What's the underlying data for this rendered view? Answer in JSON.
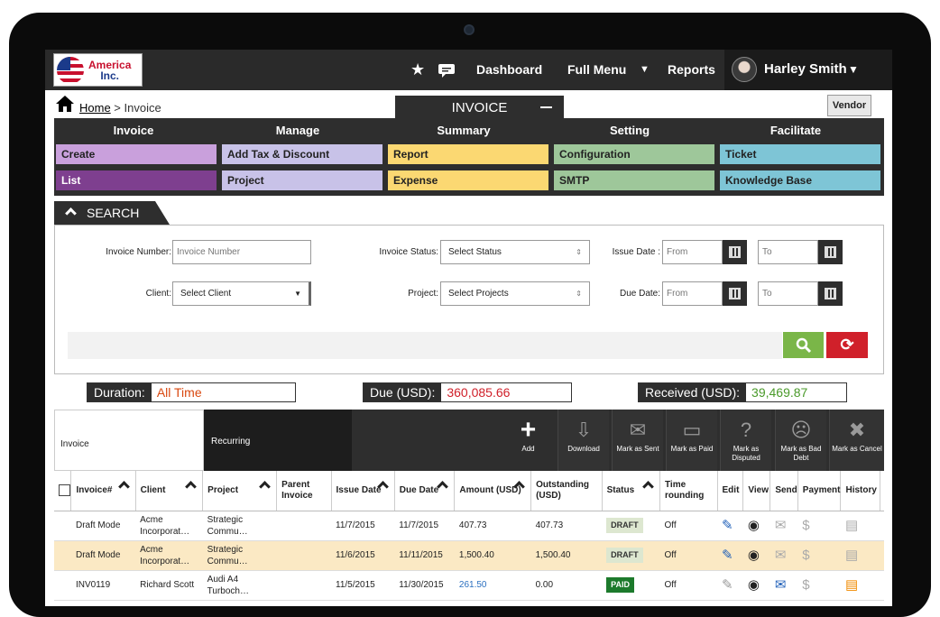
{
  "brand": {
    "line1": "America",
    "line2": "Inc."
  },
  "nav": {
    "dashboard": "Dashboard",
    "full_menu": "Full Menu",
    "reports": "Reports",
    "caret": "▼"
  },
  "user": {
    "name": "Harley Smith",
    "caret": "▼"
  },
  "breadcrumb": {
    "home": "Home",
    "sep": " > ",
    "current": "Invoice"
  },
  "invoice_tab": "INVOICE",
  "vendor_button": "Vendor",
  "menu": {
    "headers": [
      "Invoice",
      "Manage",
      "Summary",
      "Setting",
      "Facilitate"
    ],
    "items": [
      {
        "label": "Create",
        "color": "#c9a0dc"
      },
      {
        "label": "List",
        "color": "#7e3f8f"
      },
      {
        "label": "Add Tax & Discount",
        "color": "#c8c2e8"
      },
      {
        "label": "Project",
        "color": "#c8c2e8"
      },
      {
        "label": "Report",
        "color": "#fbd872"
      },
      {
        "label": "Expense",
        "color": "#fbd872"
      },
      {
        "label": "Configuration",
        "color": "#9ec79a"
      },
      {
        "label": "SMTP",
        "color": "#9ec79a"
      },
      {
        "label": "Ticket",
        "color": "#7ec5d6"
      },
      {
        "label": "Knowledge Base",
        "color": "#7ec5d6"
      }
    ]
  },
  "search": {
    "title": "SEARCH",
    "invoice_number_label": "Invoice Number:",
    "invoice_number_placeholder": "Invoice Number",
    "client_label": "Client:",
    "client_value": "Select Client",
    "status_label": "Invoice Status:",
    "status_value": "Select Status",
    "project_label": "Project:",
    "project_value": "Select Projects",
    "issue_date_label": "Issue Date :",
    "due_date_label": "Due Date:",
    "from_placeholder": "From",
    "to_placeholder": "To"
  },
  "summary": {
    "duration_label": "Duration:",
    "duration_value": "All Time",
    "due_label": "Due (USD):",
    "due_value": "360,085.66",
    "received_label": "Received (USD):",
    "received_value": "39,469.87",
    "colors": {
      "duration": "#d9480f",
      "due": "#d0202a",
      "received": "#4a9a2a"
    }
  },
  "toolbar": {
    "tab_invoice": "Invoice",
    "tab_recurring": "Recurring",
    "actions": [
      "Add",
      "Download",
      "Mark as Sent",
      "Mark as Paid",
      "Mark as Disputed",
      "Mark as Bad Debt",
      "Mark as Cancel"
    ]
  },
  "table": {
    "headers": [
      "Invoice#",
      "Client",
      "Project",
      "Parent Invoice",
      "Issue Date",
      "Due Date",
      "Amount (USD)",
      "Outstanding (USD)",
      "Status",
      "Time rounding",
      "Edit",
      "View",
      "Send",
      "Payment",
      "History"
    ],
    "rows": [
      {
        "invoice": "Draft Mode",
        "client": "Acme Incorporat…",
        "project": "Strategic Commu…",
        "parent": "",
        "issue": "11/7/2015",
        "due": "11/7/2015",
        "amount": "407.73",
        "outstanding": "407.73",
        "status": "DRAFT",
        "rounding": "Off"
      },
      {
        "invoice": "Draft Mode",
        "client": "Acme Incorporat…",
        "project": "Strategic Commu…",
        "parent": "",
        "issue": "11/6/2015",
        "due": "11/11/2015",
        "amount": "1,500.40",
        "outstanding": "1,500.40",
        "status": "DRAFT",
        "rounding": "Off"
      },
      {
        "invoice": "INV0119",
        "client": "Richard Scott",
        "project": "Audi A4 Turboch…",
        "parent": "",
        "issue": "11/5/2015",
        "due": "11/30/2015",
        "amount": "261.50",
        "outstanding": "0.00",
        "status": "PAID",
        "rounding": "Off"
      }
    ]
  }
}
